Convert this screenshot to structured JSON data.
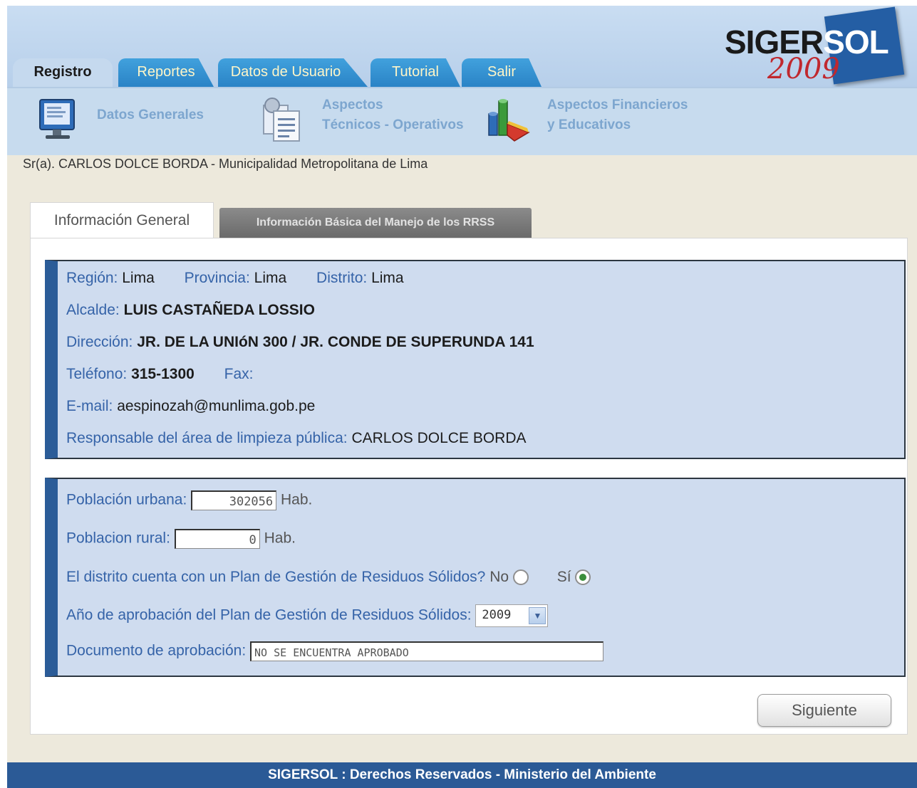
{
  "header": {
    "tabs": [
      {
        "label": "Registro",
        "active": true
      },
      {
        "label": "Reportes"
      },
      {
        "label": "Datos de Usuario"
      },
      {
        "label": "Tutorial"
      },
      {
        "label": "Salir"
      }
    ],
    "logo": {
      "part1": "SIGER",
      "part2": "SOL",
      "year": "2009"
    }
  },
  "subnav": {
    "items": [
      {
        "icon": "monitor-icon",
        "line1": "Datos Generales",
        "line2": ""
      },
      {
        "icon": "documents-icon",
        "line1": "Aspectos",
        "line2": "Técnicos - Operativos"
      },
      {
        "icon": "chart-icon",
        "line1": "Aspectos Financieros",
        "line2": "y Educativos"
      }
    ]
  },
  "user_line": "Sr(a). CARLOS DOLCE BORDA - Municipalidad Metropolitana de Lima",
  "content_tabs": [
    {
      "label": "Información General",
      "active": true
    },
    {
      "label": "Información Básica del Manejo de los RRSS"
    }
  ],
  "info": {
    "region_label": "Región:",
    "region": "Lima",
    "provincia_label": "Provincia:",
    "provincia": "Lima",
    "distrito_label": "Distrito:",
    "distrito": "Lima",
    "alcalde_label": "Alcalde:",
    "alcalde": "LUIS CASTAÑEDA LOSSIO",
    "direccion_label": "Dirección:",
    "direccion": "JR. DE LA UNIóN 300 / JR. CONDE DE SUPERUNDA 141",
    "telefono_label": "Teléfono:",
    "telefono": "315-1300",
    "fax_label": "Fax:",
    "fax": "",
    "email_label": "E-mail:",
    "email": "aespinozah@munlima.gob.pe",
    "responsable_label": "Responsable del área de limpieza pública:",
    "responsable": "CARLOS DOLCE BORDA"
  },
  "form": {
    "urbana_label": "Población urbana:",
    "urbana_value": "302056",
    "urbana_unit": "Hab.",
    "rural_label": "Poblacion rural:",
    "rural_value": "0",
    "rural_unit": "Hab.",
    "plan_question": "El distrito cuenta con un Plan de Gestión de Residuos Sólidos?",
    "plan_no_label": "No",
    "plan_si_label": "Sí",
    "plan_selected": "Sí",
    "anio_label": "Año de aprobación del Plan de Gestión de Residuos Sólidos:",
    "anio_value": "2009",
    "documento_label": "Documento de aprobación:",
    "documento_value": "NO SE ENCUENTRA APROBADO",
    "next_button": "Siguiente"
  },
  "footer": "SIGERSOL : Derechos Reservados - Ministerio del Ambiente",
  "colors": {
    "primary": "#2b5c98",
    "tab_blue": "#3493d3",
    "label_blue": "#3563a8",
    "logo_red": "#c0282e"
  }
}
